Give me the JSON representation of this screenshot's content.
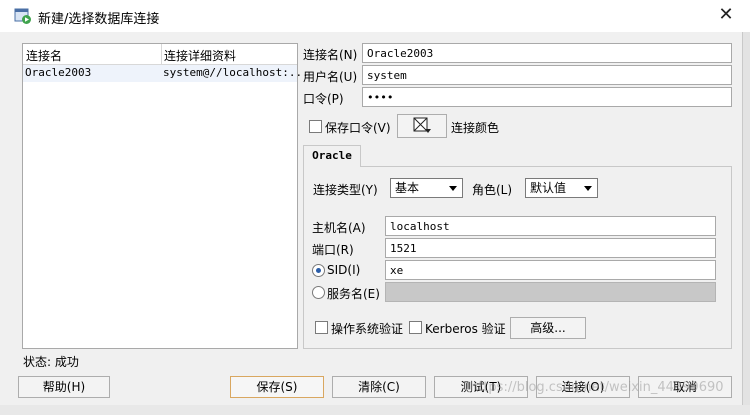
{
  "window": {
    "title": "新建/选择数据库连接",
    "close_glyph": "✕"
  },
  "connection_list": {
    "headers": [
      "连接名",
      "连接详细资料"
    ],
    "rows": [
      {
        "name": "Oracle2003",
        "details": "system@//localhost:..."
      }
    ]
  },
  "form": {
    "conn_name_label": "连接名(N)",
    "conn_name_value": "Oracle2003",
    "username_label": "用户名(U)",
    "username_value": "system",
    "password_label": "口令(P)",
    "password_value": "••••",
    "save_password_label": "保存口令(V)",
    "conn_color_label": "连接颜色"
  },
  "tab": {
    "label": "Oracle"
  },
  "oracle": {
    "conn_type_label": "连接类型(Y)",
    "conn_type_value": "基本",
    "role_label": "角色(L)",
    "role_value": "默认值",
    "host_label": "主机名(A)",
    "host_value": "localhost",
    "port_label": "端口(R)",
    "port_value": "1521",
    "sid_label": "SID(I)",
    "sid_value": "xe",
    "service_label": "服务名(E)",
    "os_auth_label": "操作系统验证",
    "kerberos_label": "Kerberos 验证",
    "advanced_label": "高级..."
  },
  "status": {
    "text": "状态: 成功"
  },
  "buttons": {
    "help": "帮助(H)",
    "save": "保存(S)",
    "clear": "清除(C)",
    "test": "测试(T)",
    "connect": "连接(O)",
    "cancel": "取消"
  },
  "watermark": "https://blog.csdn.net/weixin_44399690"
}
